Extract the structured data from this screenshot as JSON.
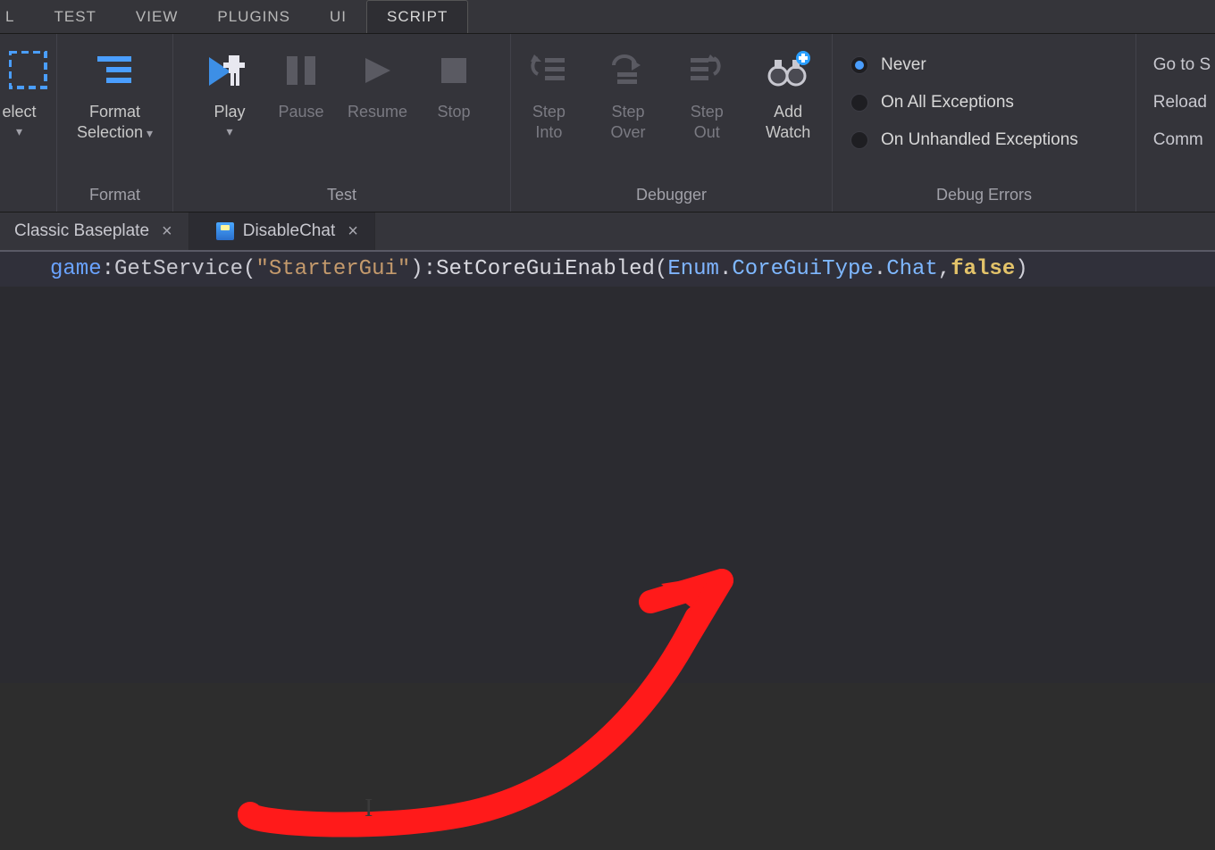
{
  "menu": {
    "tabs": [
      "L",
      "TEST",
      "VIEW",
      "PLUGINS",
      "UI",
      "SCRIPT"
    ],
    "active": "SCRIPT"
  },
  "ribbon": {
    "groups": {
      "select": {
        "label": "",
        "btn": "elect"
      },
      "format": {
        "label": "Format",
        "btn": "Format Selection"
      },
      "test": {
        "label": "Test",
        "play": "Play",
        "pause": "Pause",
        "resume": "Resume",
        "stop": "Stop"
      },
      "debugger": {
        "label": "Debugger",
        "stepInto": "Step Into",
        "stepOver": "Step Over",
        "stepOut": "Step Out",
        "addWatch": "Add Watch"
      },
      "debugErrors": {
        "label": "Debug Errors",
        "never": "Never",
        "onAll": "On All Exceptions",
        "onUnhandled": "On Unhandled Exceptions"
      },
      "side": {
        "goto": "Go to S",
        "reload": "Reload",
        "comm": "Comm"
      }
    }
  },
  "fileTabs": {
    "classic": "Classic Baseplate",
    "disableChat": "DisableChat"
  },
  "code": {
    "t1": "game",
    "t2": ":",
    "t3": "GetService",
    "t4": "(",
    "t5": "\"StarterGui\"",
    "t6": ")",
    "t7": ":",
    "t8": "SetCoreGuiEnabled",
    "t9": "(",
    "t10": "Enum",
    "t11": ".",
    "t12": "CoreGuiType",
    "t13": ".",
    "t14": "Chat",
    "t15": ",",
    "t16": "false",
    "t17": ")"
  }
}
